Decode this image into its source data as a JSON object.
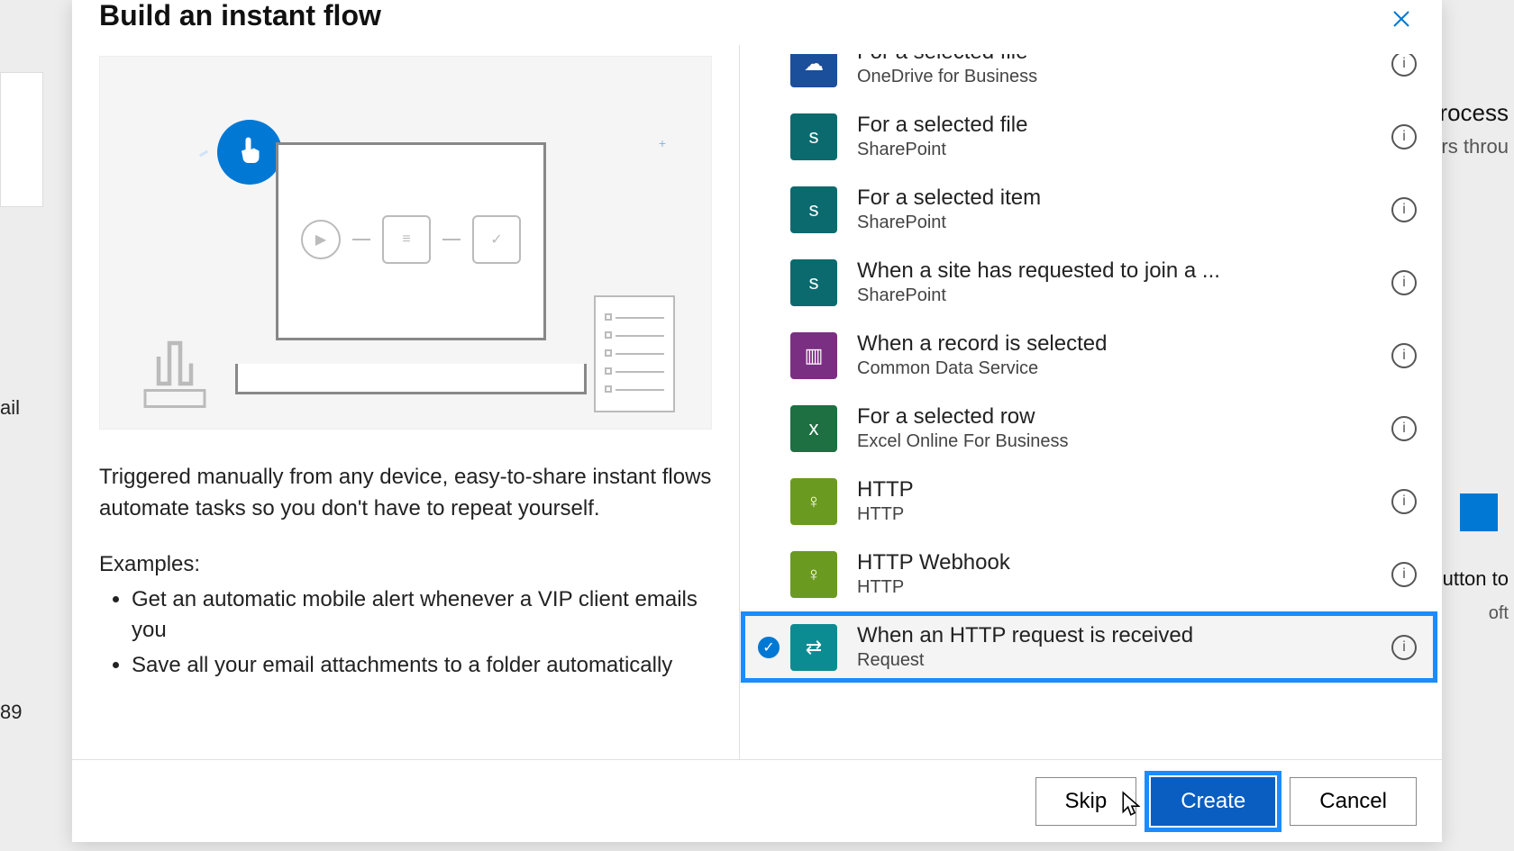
{
  "dialog": {
    "title": "Build an instant flow",
    "description": "Triggered manually from any device, easy-to-share instant flows automate tasks so you don't have to repeat yourself.",
    "examples_label": "Examples:",
    "examples": [
      "Get an automatic mobile alert whenever a VIP client emails you",
      "Save all your email attachments to a folder automatically"
    ],
    "buttons": {
      "skip": "Skip",
      "create": "Create",
      "cancel": "Cancel"
    }
  },
  "triggers": [
    {
      "title": "For a selected file",
      "subtitle": "OneDrive for Business",
      "icon_name": "onedrive-icon",
      "color": "c-onedrive",
      "selected": false,
      "partial": true
    },
    {
      "title": "For a selected file",
      "subtitle": "SharePoint",
      "icon_name": "sharepoint-icon",
      "color": "c-sp",
      "selected": false
    },
    {
      "title": "For a selected item",
      "subtitle": "SharePoint",
      "icon_name": "sharepoint-icon",
      "color": "c-sp",
      "selected": false
    },
    {
      "title": "When a site has requested to join a ...",
      "subtitle": "SharePoint",
      "icon_name": "sharepoint-icon",
      "color": "c-sp",
      "selected": false
    },
    {
      "title": "When a record is selected",
      "subtitle": "Common Data Service",
      "icon_name": "cds-icon",
      "color": "c-cds",
      "selected": false
    },
    {
      "title": "For a selected row",
      "subtitle": "Excel Online For Business",
      "icon_name": "excel-icon",
      "color": "c-excel",
      "selected": false
    },
    {
      "title": "HTTP",
      "subtitle": "HTTP",
      "icon_name": "http-icon",
      "color": "c-http",
      "selected": false
    },
    {
      "title": "HTTP Webhook",
      "subtitle": "HTTP",
      "icon_name": "http-icon",
      "color": "c-http",
      "selected": false
    },
    {
      "title": "When an HTTP request is received",
      "subtitle": "Request",
      "icon_name": "request-icon",
      "color": "c-req",
      "selected": true
    }
  ],
  "background": {
    "text1": "process",
    "text2": "ers throu",
    "text3": "button to",
    "text4": "oft",
    "mail": "ail",
    "num": "89"
  }
}
